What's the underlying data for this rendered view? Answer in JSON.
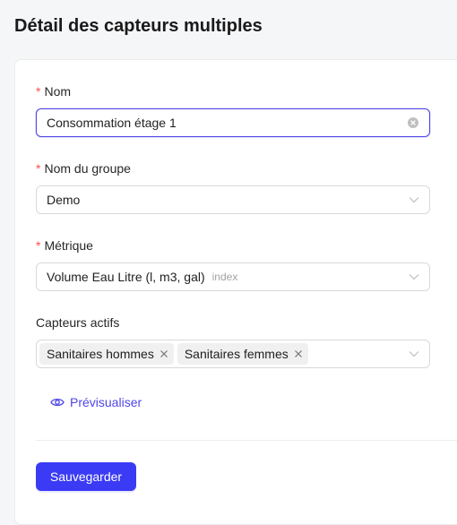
{
  "page": {
    "title": "Détail des capteurs multiples"
  },
  "form": {
    "required_mark": "*",
    "name": {
      "label": "Nom",
      "value": "Consommation étage 1"
    },
    "group": {
      "label": "Nom du groupe",
      "value": "Demo"
    },
    "metric": {
      "label": "Métrique",
      "value": "Volume Eau Litre (l, m3, gal)",
      "hint": "index"
    },
    "sensors": {
      "label": "Capteurs actifs",
      "tags": [
        "Sanitaires hommes",
        "Sanitaires femmes"
      ]
    },
    "preview_label": "Prévisualiser",
    "save_label": "Sauvegarder"
  },
  "colors": {
    "accent": "#4f46e5",
    "button": "#3b3bf5",
    "required": "#ff4d4f"
  },
  "icons": {
    "clear": "clear-icon",
    "chevron": "chevron-down-icon",
    "tag_close": "close-icon",
    "preview": "eye-icon"
  }
}
